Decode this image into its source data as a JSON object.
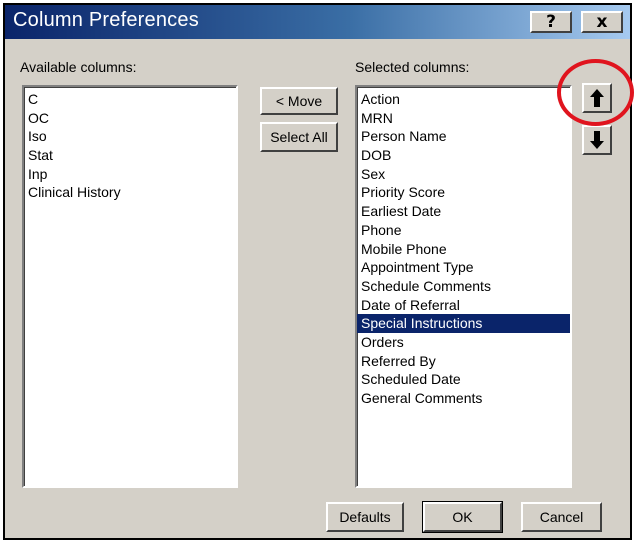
{
  "window": {
    "title": "Column Preferences",
    "help_label": "?",
    "close_label": "x"
  },
  "available": {
    "label": "Available columns:",
    "items": [
      "C",
      "OC",
      "Iso",
      "Stat",
      "Inp",
      "Clinical History"
    ]
  },
  "selected": {
    "label": "Selected columns:",
    "items": [
      "Action",
      "MRN",
      "Person Name",
      "DOB",
      "Sex",
      "Priority Score",
      "Earliest Date",
      "Phone",
      "Mobile Phone",
      "Appointment Type",
      "Schedule Comments",
      "Date of Referral",
      "Special Instructions",
      "Orders",
      "Referred By",
      "Scheduled Date",
      "General Comments"
    ],
    "selected_item": "Special Instructions"
  },
  "buttons": {
    "move": "< Move",
    "select_all": "Select All",
    "defaults": "Defaults",
    "ok": "OK",
    "cancel": "Cancel"
  },
  "icons": {
    "move_up": "arrow-up-icon",
    "move_down": "arrow-down-icon"
  },
  "colors": {
    "selection": "#0a246a",
    "highlight_circle": "#e0141e"
  }
}
